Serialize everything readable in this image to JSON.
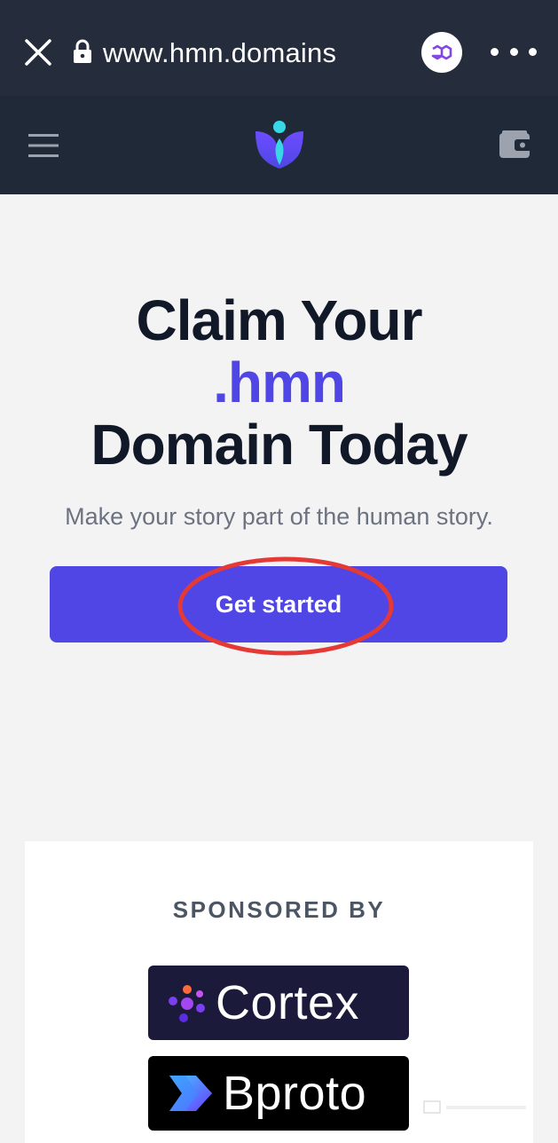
{
  "browser": {
    "url": "www.hmn.domains",
    "close_icon": "close-icon",
    "lock_icon": "lock-icon",
    "extension_icon": "polygon-icon",
    "more_icon": "more-dots-icon"
  },
  "header": {
    "menu_icon": "hamburger-menu-icon",
    "logo_icon": "hmn-logo-icon",
    "wallet_icon": "wallet-icon"
  },
  "hero": {
    "title_line1": "Claim Your",
    "title_accent": ".hmn",
    "title_line3": "Domain Today",
    "subtitle": "Make your story part of the human story.",
    "cta_label": "Get started"
  },
  "sponsors": {
    "heading": "SPONSORED BY",
    "items": [
      {
        "name": "Cortex"
      },
      {
        "name": "Bproto"
      }
    ]
  },
  "colors": {
    "accent": "#4f46e5",
    "browser_bar": "#252c3b",
    "site_header": "#1f2937",
    "annotation": "#e53935"
  }
}
